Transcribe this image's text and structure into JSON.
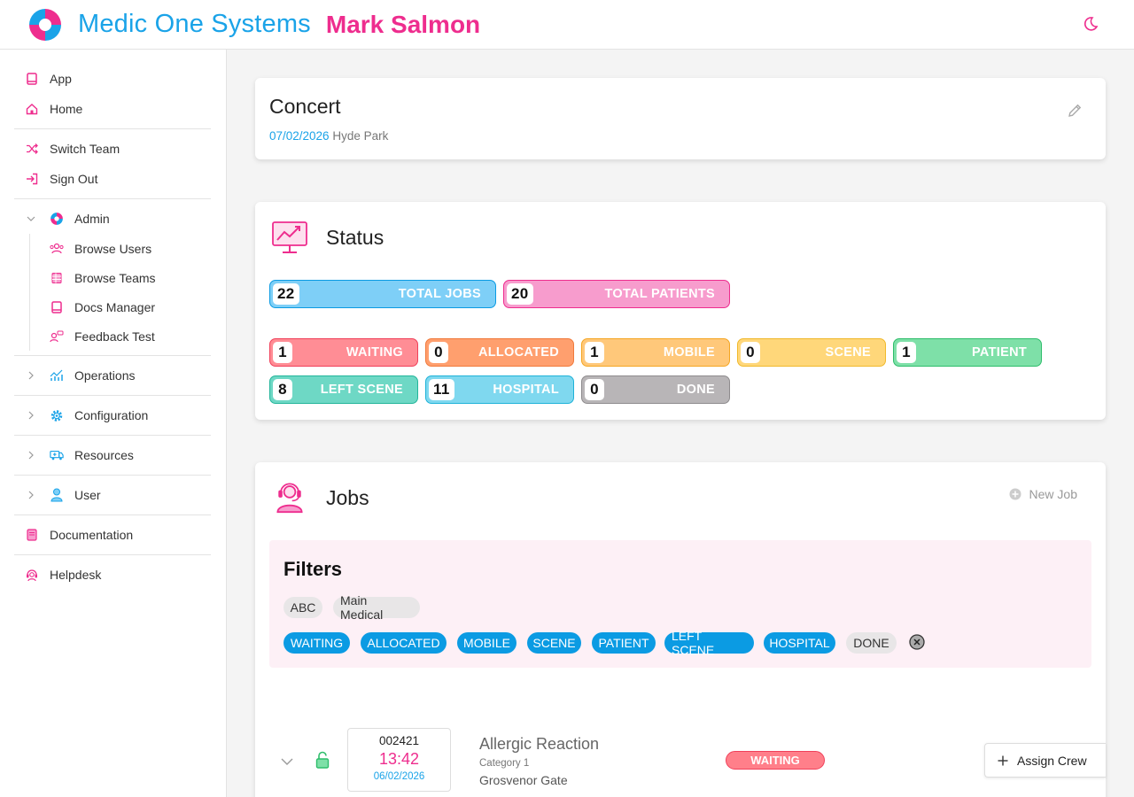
{
  "header": {
    "app_title": "Medic One Systems",
    "user_name": "Mark Salmon",
    "logo_icon": "medic-logo-icon",
    "theme_icon": "moon-icon"
  },
  "sidebar": {
    "items": [
      {
        "label": "App",
        "icon": "book-icon"
      },
      {
        "label": "Home",
        "icon": "home-icon"
      },
      {
        "label": "Switch Team",
        "icon": "shuffle-icon"
      },
      {
        "label": "Sign Out",
        "icon": "sign-out-icon"
      },
      {
        "label": "Admin",
        "icon": "medic-logo-icon"
      },
      {
        "label": "Browse Users",
        "icon": "users-icon"
      },
      {
        "label": "Browse Teams",
        "icon": "table-icon"
      },
      {
        "label": "Docs Manager",
        "icon": "book-icon"
      },
      {
        "label": "Feedback Test",
        "icon": "feedback-icon"
      },
      {
        "label": "Operations",
        "icon": "chart-icon"
      },
      {
        "label": "Configuration",
        "icon": "gear-icon"
      },
      {
        "label": "Resources",
        "icon": "ambulance-icon"
      },
      {
        "label": "User",
        "icon": "user-icon"
      },
      {
        "label": "Documentation",
        "icon": "book-icon"
      },
      {
        "label": "Helpdesk",
        "icon": "headset-icon"
      }
    ]
  },
  "event": {
    "title": "Concert",
    "date": "07/02/2026",
    "location": "Hyde Park"
  },
  "status": {
    "title": "Status",
    "totals": [
      {
        "value": "22",
        "label": "TOTAL JOBS",
        "bg": "#7ecff7",
        "border": "#0b9be3"
      },
      {
        "value": "20",
        "label": "TOTAL PATIENTS",
        "bg": "#f79ccd",
        "border": "#ee2d8e"
      }
    ],
    "counts": [
      {
        "value": "1",
        "label": "WAITING",
        "bg": "#ff8d95",
        "border": "#f0405a"
      },
      {
        "value": "0",
        "label": "ALLOCATED",
        "bg": "#ff9f6e",
        "border": "#f07a3c"
      },
      {
        "value": "1",
        "label": "MOBILE",
        "bg": "#ffc87a",
        "border": "#f5a623"
      },
      {
        "value": "0",
        "label": "SCENE",
        "bg": "#ffd77a",
        "border": "#f0b92c"
      },
      {
        "value": "1",
        "label": "PATIENT",
        "bg": "#7ee0a8",
        "border": "#2ebd6b"
      },
      {
        "value": "8",
        "label": "LEFT SCENE",
        "bg": "#6ed8c5",
        "border": "#22b59a"
      },
      {
        "value": "11",
        "label": "HOSPITAL",
        "bg": "#7fd8ef",
        "border": "#1eb2d8"
      },
      {
        "value": "0",
        "label": "DONE",
        "bg": "#b8b5b7",
        "border": "#8e8b8d"
      }
    ]
  },
  "jobs": {
    "title": "Jobs",
    "new_job_label": "New Job",
    "filters": {
      "title": "Filters",
      "groups": [
        "ABC",
        "Main Medical"
      ],
      "statuses": [
        {
          "label": "WAITING",
          "active": true
        },
        {
          "label": "ALLOCATED",
          "active": true
        },
        {
          "label": "MOBILE",
          "active": true
        },
        {
          "label": "SCENE",
          "active": true
        },
        {
          "label": "PATIENT",
          "active": true
        },
        {
          "label": "LEFT SCENE",
          "active": true
        },
        {
          "label": "HOSPITAL",
          "active": true
        },
        {
          "label": "DONE",
          "active": false
        }
      ]
    },
    "rows": [
      {
        "id": "002421",
        "time": "13:42",
        "date": "06/02/2026",
        "title": "Allergic Reaction",
        "category": "Category 1",
        "location": "Grosvenor Gate",
        "status": "WAITING",
        "action_label": "Assign Crew"
      }
    ]
  },
  "colors": {
    "brand_blue": "#1aa3e8",
    "brand_pink": "#ee2d8e",
    "filter_bg": "#fdf0f6"
  }
}
